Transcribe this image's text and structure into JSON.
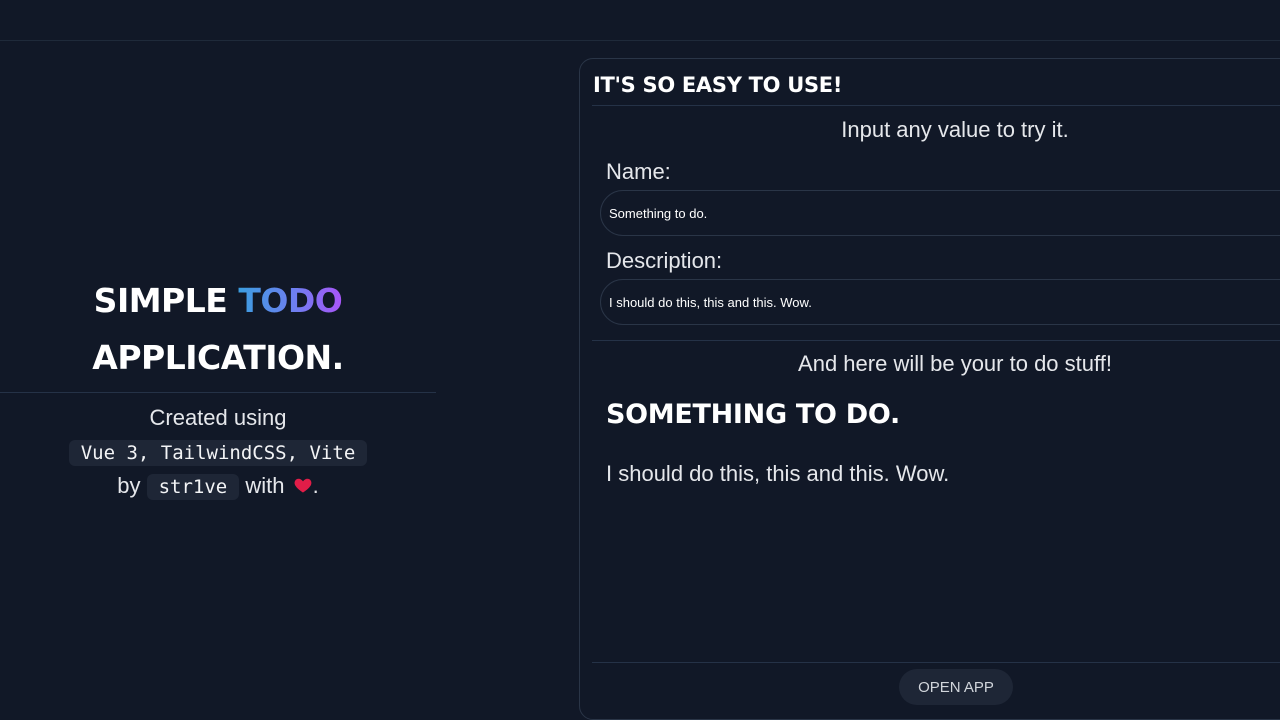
{
  "hero": {
    "title_part1": "SIMPLE ",
    "title_accent": "TODO",
    "title_part2": "APPLICATION.",
    "created_text": "Created using",
    "stack_chip": "Vue 3, TailwindCSS, Vite",
    "by_text": "by",
    "author_chip": "str1ve",
    "with_text": "with",
    "end_text": ".",
    "gradient_colors": [
      "#3b9ee0",
      "#6f7ef0",
      "#a855f7"
    ],
    "heart_color": "#e11d48"
  },
  "card": {
    "header": "IT'S SO EASY TO USE!",
    "intro": "Input any value to try it.",
    "name_label": "Name:",
    "name_value": "Something to do.",
    "description_label": "Description:",
    "description_value": "I should do this, this and this. Wow.",
    "preview_intro": "And here will be your to do stuff!",
    "preview_title": "SOMETHING TO DO.",
    "preview_description": "I should do this, this and this. Wow.",
    "open_button": "OPEN APP"
  }
}
